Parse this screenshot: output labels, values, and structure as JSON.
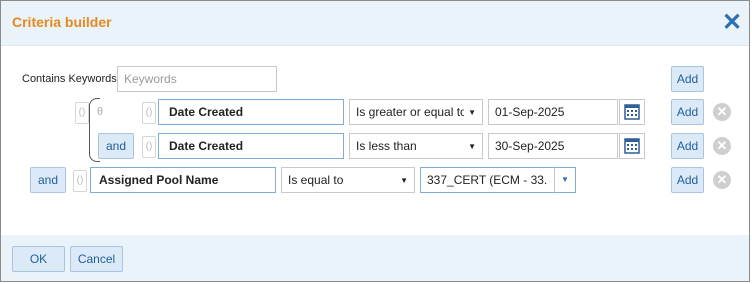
{
  "dialog": {
    "title": "Criteria builder",
    "close_icon": "close-icon"
  },
  "keywords": {
    "label": "Contains Keywords",
    "placeholder": "Keywords",
    "add_label": "Add"
  },
  "rows": [
    {
      "connector": "",
      "paren_open": "()",
      "theta": "θ",
      "field": "Date Created",
      "operator": "Is greater or equal to",
      "value": "01-Sep-2025",
      "add_label": "Add"
    },
    {
      "connector": "and",
      "paren_open": "()",
      "field": "Date Created",
      "operator": "Is less than",
      "value": "30-Sep-2025",
      "add_label": "Add"
    },
    {
      "connector": "and",
      "paren_open": "()",
      "field": "Assigned Pool Name",
      "operator": "Is equal to",
      "value": "337_CERT (ECM - 33...",
      "add_label": "Add"
    }
  ],
  "footer": {
    "ok_label": "OK",
    "cancel_label": "Cancel"
  },
  "colors": {
    "title": "#e58a1f",
    "accent": "#2e6fb0",
    "header_bg": "#eaf2fa"
  }
}
